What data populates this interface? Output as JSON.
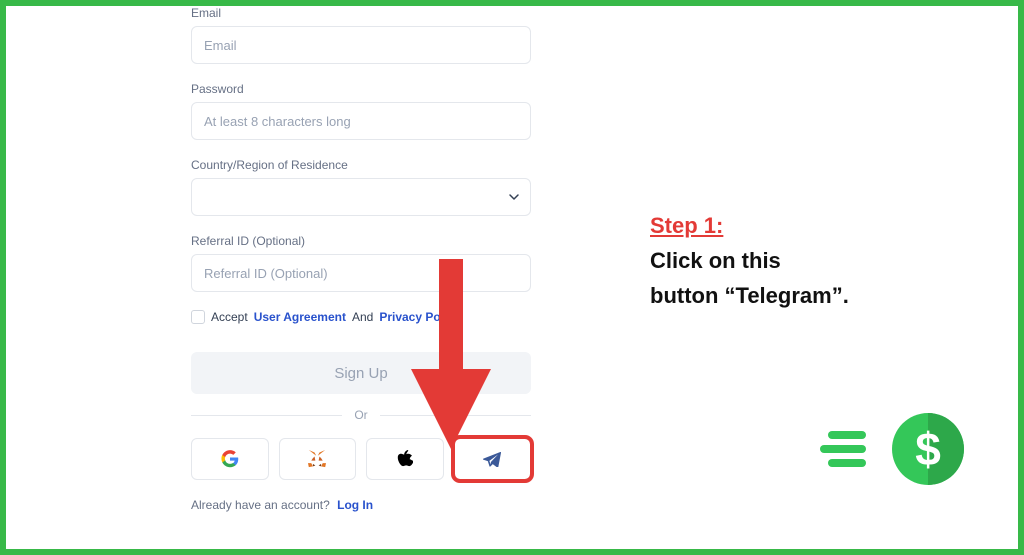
{
  "form": {
    "email": {
      "label": "Email",
      "placeholder": "Email"
    },
    "password": {
      "label": "Password",
      "placeholder": "At least 8 characters long"
    },
    "country": {
      "label": "Country/Region of Residence"
    },
    "referral": {
      "label": "Referral ID (Optional)",
      "placeholder": "Referral ID (Optional)"
    },
    "accept": {
      "prefix": "Accept",
      "user_agreement": "User Agreement",
      "and": "And",
      "privacy_policy": "Privacy Policy"
    },
    "signup_label": "Sign Up",
    "or_label": "Or",
    "already_text": "Already have an account?",
    "login_label": "Log In"
  },
  "socials": {
    "google": "google",
    "metamask": "metamask",
    "apple": "apple",
    "telegram": "telegram"
  },
  "instruction": {
    "step_label": "Step 1:",
    "line1": "Click on this",
    "line2": "button “Telegram”."
  },
  "colors": {
    "frame": "#38b948",
    "highlight": "#e33a36",
    "link": "#2952cc"
  }
}
